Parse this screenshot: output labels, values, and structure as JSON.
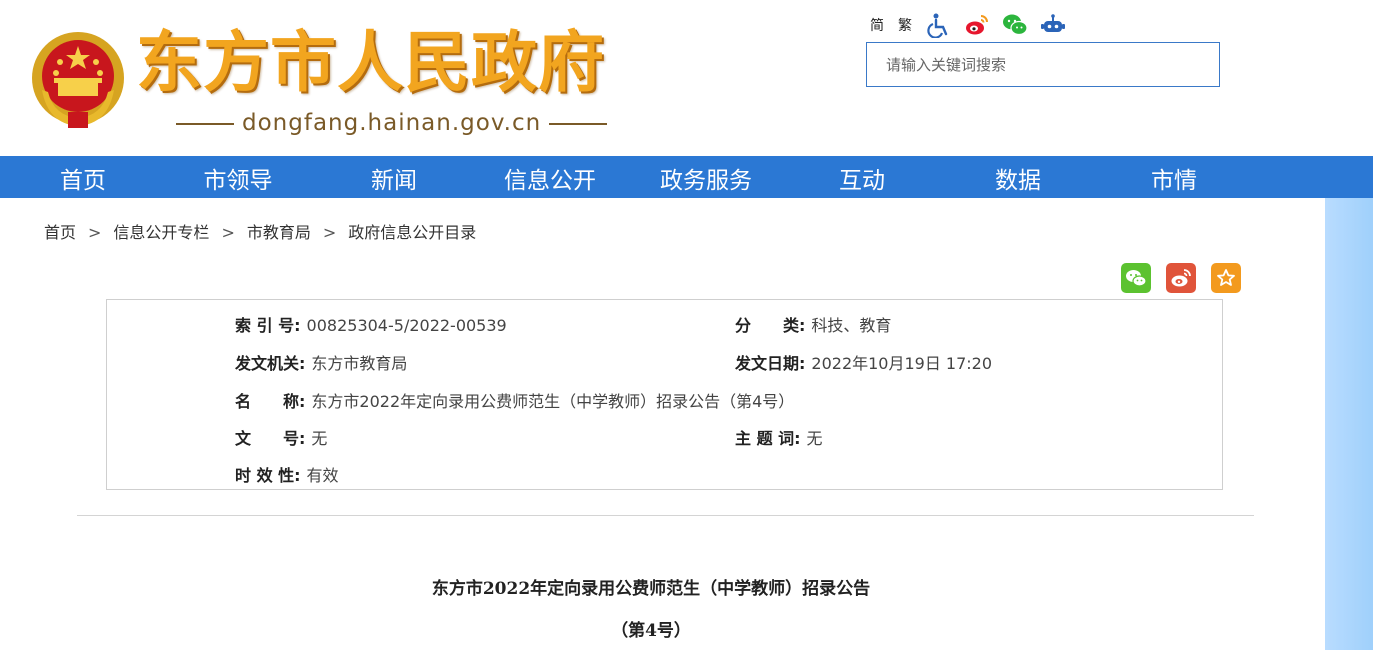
{
  "header": {
    "title": "东方市人民政府",
    "domain": "dongfang.hainan.gov.cn",
    "lang_simplified": "简",
    "lang_traditional": "繁",
    "search_placeholder": "请输入关键词搜索"
  },
  "nav": {
    "items": [
      "首页",
      "市领导",
      "新闻",
      "信息公开",
      "政务服务",
      "互动",
      "数据",
      "市情"
    ]
  },
  "breadcrumb": {
    "items": [
      "首页",
      "信息公开专栏",
      "市教育局",
      "政府信息公开目录"
    ],
    "separator": ">"
  },
  "meta": {
    "index_label": "索 引 号:",
    "index_value": "00825304-5/2022-00539",
    "category_label": "分　　类:",
    "category_value": "科技、教育",
    "issuer_label": "发文机关:",
    "issuer_value": "东方市教育局",
    "date_label": "发文日期:",
    "date_value": "2022年10月19日 17:20",
    "name_label": "名　　称:",
    "name_value": "东方市2022年定向录用公费师范生（中学教师）招录公告（第4号）",
    "docno_label": "文　　号:",
    "docno_value": "无",
    "keywords_label": "主 题 词:",
    "keywords_value": "无",
    "validity_label": "时 效 性:",
    "validity_value": "有效"
  },
  "document": {
    "title": "东方市2022年定向录用公费师范生（中学教师）招录公告",
    "subtitle": "（第4号）"
  },
  "colors": {
    "nav_bg": "#2b78d4",
    "title_gold": "#f2a51f",
    "domain_brown": "#7a5a28",
    "wechat_green": "#5cc230",
    "weibo_red": "#e0543a",
    "favorite_orange": "#f39a1e"
  }
}
